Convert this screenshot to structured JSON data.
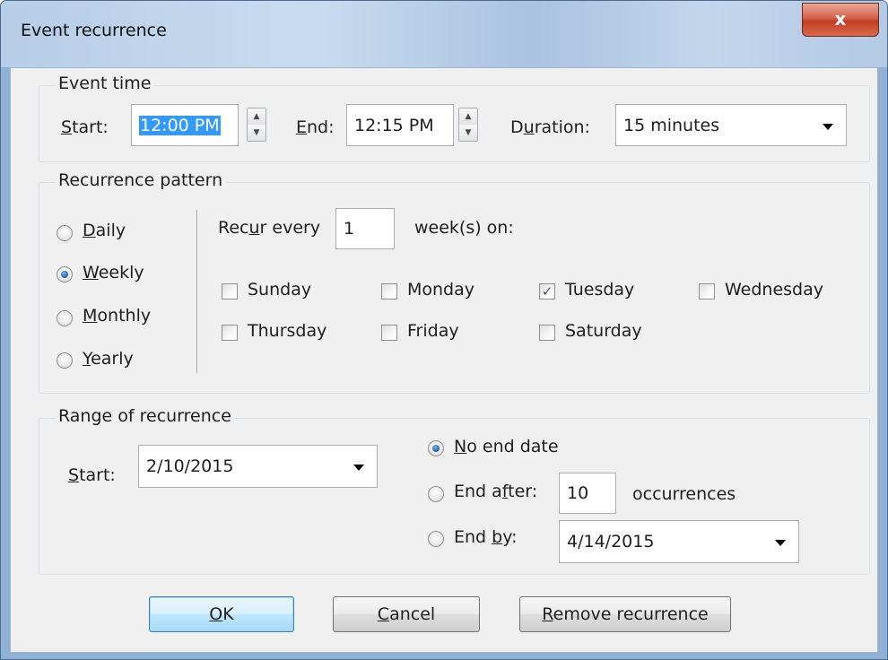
{
  "window": {
    "title": "Event recurrence",
    "close_label": "x"
  },
  "event_time": {
    "group_label": "Event time",
    "start_label_u": "S",
    "start_label_rest": "tart:",
    "start_value": "12:00 PM",
    "end_label_u": "E",
    "end_label_rest": "nd:",
    "end_value": "12:15 PM",
    "duration_label_pre": "D",
    "duration_label_u": "u",
    "duration_label_rest": "ration:",
    "duration_value": "15 minutes"
  },
  "recurrence_pattern": {
    "group_label": "Recurrence pattern",
    "frequency": [
      {
        "u": "D",
        "rest": "aily",
        "selected": false
      },
      {
        "u": "W",
        "rest": "eekly",
        "selected": true
      },
      {
        "u": "M",
        "rest": "onthly",
        "selected": false
      },
      {
        "u": "Y",
        "rest": "early",
        "selected": false
      }
    ],
    "recur_every_pre": "Rec",
    "recur_every_u": "u",
    "recur_every_rest": "r every",
    "recur_every_value": "1",
    "recur_every_suffix": "week(s) on:",
    "days": [
      {
        "label": "Sunday",
        "checked": false
      },
      {
        "label": "Monday",
        "checked": false
      },
      {
        "label": "Tuesday",
        "checked": true
      },
      {
        "label": "Wednesday",
        "checked": false
      },
      {
        "label": "Thursday",
        "checked": false
      },
      {
        "label": "Friday",
        "checked": false
      },
      {
        "label": "Saturday",
        "checked": false
      }
    ],
    "check_glyph": "✓"
  },
  "range": {
    "group_label": "Range of recurrence",
    "start_label_u": "S",
    "start_label_rest": "tart:",
    "start_value": "2/10/2015",
    "no_end_u": "N",
    "no_end_rest": "o end date",
    "end_after_pre": "End a",
    "end_after_u": "f",
    "end_after_rest": "ter:",
    "end_after_value": "10",
    "occurrences_label": "occurrences",
    "end_by_pre": "End ",
    "end_by_u": "b",
    "end_by_rest": "y:",
    "end_by_value": "4/14/2015",
    "selected_option": "no_end_date"
  },
  "buttons": {
    "ok_u": "O",
    "ok_rest": "K",
    "cancel_u": "C",
    "cancel_rest": "ancel",
    "remove_u": "R",
    "remove_rest": "emove recurrence"
  }
}
